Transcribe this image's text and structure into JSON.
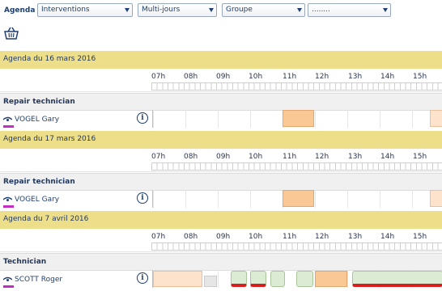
{
  "toolbar": {
    "label": "Agenda",
    "selects": [
      {
        "value": "Interventions"
      },
      {
        "value": "Multi-jours"
      },
      {
        "value": "Groupe"
      },
      {
        "value": "........"
      }
    ],
    "basket_icon": "basket-icon"
  },
  "hours": [
    "07h",
    "08h",
    "09h",
    "10h",
    "11h",
    "12h",
    "13h",
    "14h",
    "15h"
  ],
  "sections": [
    {
      "title": "Agenda du 16 mars 2016",
      "group": "Repair technician",
      "person": "VOGEL Gary"
    },
    {
      "title": "Agenda du 17 mars 2016",
      "group": "Repair technician",
      "person": "VOGEL Gary"
    },
    {
      "title": "Agenda du 7 avril 2016",
      "group": "Technician",
      "person": "SCOTT Roger"
    }
  ],
  "colors": {
    "band": "#eddf8a",
    "orange_block": "#f9c894",
    "light_orange": "#fde3cb",
    "green_block": "#dcebd3",
    "red_marker": "#d62020",
    "gray_block": "#e6e6e6"
  }
}
